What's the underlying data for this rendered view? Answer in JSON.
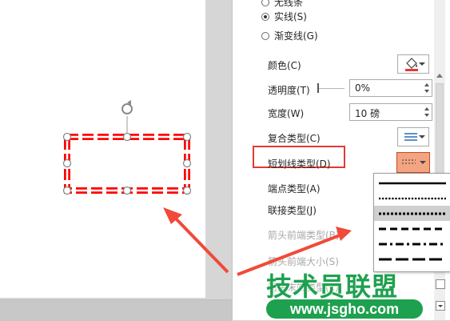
{
  "colors": {
    "accent_red": "#e53935",
    "dash_selected": "#f3a482",
    "watermark_green": "#1ea14f"
  },
  "panel": {
    "fill_types": [
      {
        "label": "无线条",
        "checked": false
      },
      {
        "label": "实线(S)",
        "checked": true
      },
      {
        "label": "渐变线(G)",
        "checked": false
      }
    ],
    "color_label": "颜色(C)",
    "transparency_label": "透明度(T)",
    "transparency_value": "0%",
    "width_label": "宽度(W)",
    "width_value": "10 磅",
    "compound_label": "复合类型(C)",
    "dash_label": "短划线类型(D)",
    "cap_label": "端点类型(A)",
    "join_label": "联接类型(J)",
    "begin_arrow_type_label": "箭头前端类型(B)",
    "begin_arrow_size_label": "箭头前端大小(S)",
    "end_arrow_type_label": "箭头末端类型(E)"
  },
  "dash_options": [
    {
      "name": "solid",
      "selected": false
    },
    {
      "name": "round-dot",
      "selected": false
    },
    {
      "name": "square-dot",
      "selected": true
    },
    {
      "name": "dash",
      "selected": false
    },
    {
      "name": "dash-dot",
      "selected": false
    },
    {
      "name": "long-dash",
      "selected": false
    }
  ],
  "icons": [
    "rotate-handle-icon",
    "paint-bucket-icon",
    "compound-lines-icon",
    "dash-pattern-icon",
    "chevron-down-icon"
  ],
  "watermark": {
    "line1": "技术员联盟",
    "line2": "www.jsgho.com"
  }
}
